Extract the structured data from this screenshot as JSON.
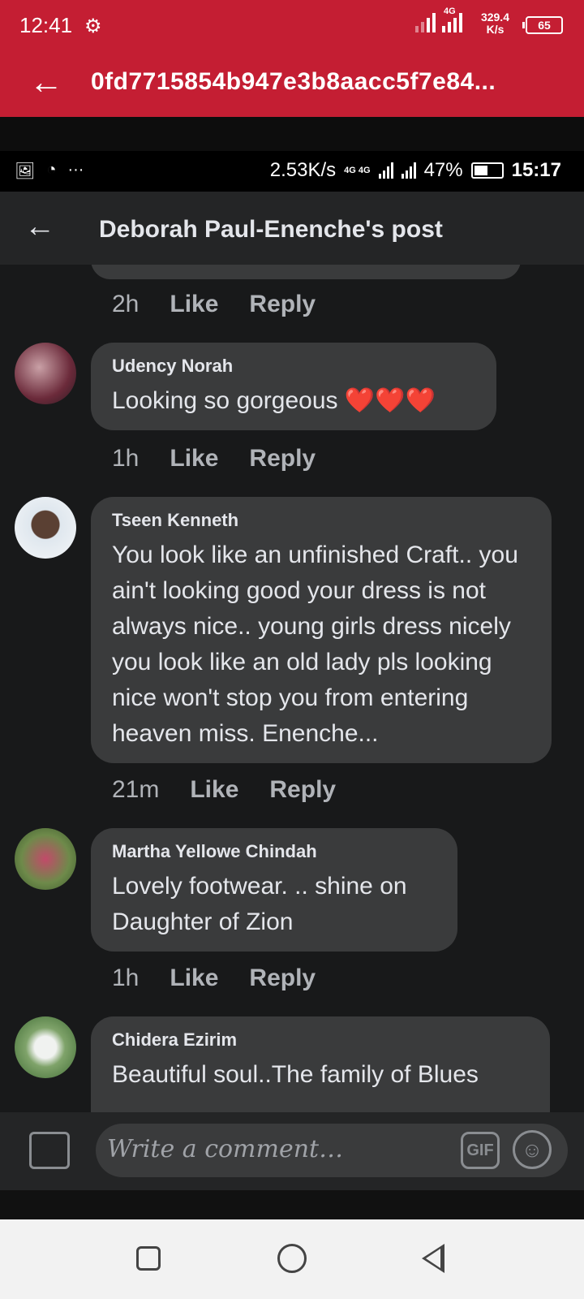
{
  "outer_status": {
    "time": "12:41",
    "network_type": "4G",
    "net_speed_value": "329.4",
    "net_speed_unit": "K/s",
    "battery": "65"
  },
  "app_bar": {
    "title": "0fd7715854b947e3b8aacc5f7e84..."
  },
  "inner_status": {
    "net_speed": "2.53K/s",
    "net_type": "4G 4G",
    "battery_percent": "47%",
    "time": "15:17"
  },
  "fb_header": {
    "title": "Deborah Paul-Enenche's post"
  },
  "previous_comment_meta": {
    "time": "2h",
    "like": "Like",
    "reply": "Reply"
  },
  "comments": [
    {
      "author": "Udency Norah",
      "text": "Looking so gorgeous ❤️❤️❤️",
      "time": "1h",
      "like": "Like",
      "reply": "Reply"
    },
    {
      "author": "Tseen Kenneth",
      "text": "You look like an unfinished Craft.. you ain't looking good your dress is not always nice.. young girls dress nicely you look like an old lady pls looking nice won't stop you from entering heaven miss. Enenche...",
      "time": "21m",
      "like": "Like",
      "reply": "Reply"
    },
    {
      "author": "Martha Yellowe Chindah",
      "text": "Lovely footwear. .. shine on Daughter of Zion",
      "time": "1h",
      "like": "Like",
      "reply": "Reply"
    },
    {
      "author": "Chidera Ezirim",
      "text": "Beautiful soul..The family of Blues"
    }
  ],
  "composer": {
    "placeholder": "Write a comment…",
    "gif_label": "GIF"
  },
  "colors": {
    "brand_red": "#c41e33",
    "bubble": "#3a3b3c",
    "background": "#18191a"
  }
}
